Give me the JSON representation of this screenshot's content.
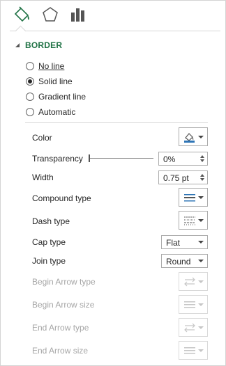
{
  "tabs": [
    {
      "name": "fill-and-line",
      "icon": "paint-bucket-icon",
      "selected": true
    },
    {
      "name": "effects",
      "icon": "pentagon-icon",
      "selected": false
    },
    {
      "name": "size-and-properties",
      "icon": "bar-chart-icon",
      "selected": false
    }
  ],
  "section": {
    "title": "BORDER",
    "expanded": true
  },
  "border_options": [
    {
      "label": "No line",
      "selected": false
    },
    {
      "label": "Solid line",
      "selected": true
    },
    {
      "label": "Gradient line",
      "selected": false
    },
    {
      "label": "Automatic",
      "selected": false
    }
  ],
  "properties": {
    "color": {
      "label": "Color",
      "icon": "pen-color-icon",
      "accent": "#2e75b6"
    },
    "transparency": {
      "label": "Transparency",
      "value": "0%",
      "level": 0
    },
    "width": {
      "label": "Width",
      "value": "0.75 pt"
    },
    "compound_type": {
      "label": "Compound type",
      "icon": "compound-lines-icon"
    },
    "dash_type": {
      "label": "Dash type",
      "icon": "dash-lines-icon"
    },
    "cap_type": {
      "label": "Cap type",
      "value": "Flat"
    },
    "join_type": {
      "label": "Join type",
      "value": "Round"
    },
    "begin_arrow_type": {
      "label": "Begin Arrow type",
      "icon": "arrow-type-icon",
      "disabled": true
    },
    "begin_arrow_size": {
      "label": "Begin Arrow size",
      "icon": "arrow-size-icon",
      "disabled": true
    },
    "end_arrow_type": {
      "label": "End Arrow type",
      "icon": "arrow-type-icon",
      "disabled": true
    },
    "end_arrow_size": {
      "label": "End Arrow size",
      "icon": "arrow-size-icon",
      "disabled": true
    }
  },
  "colors": {
    "accent_green": "#217346",
    "icon_blue": "#2e75b6"
  }
}
